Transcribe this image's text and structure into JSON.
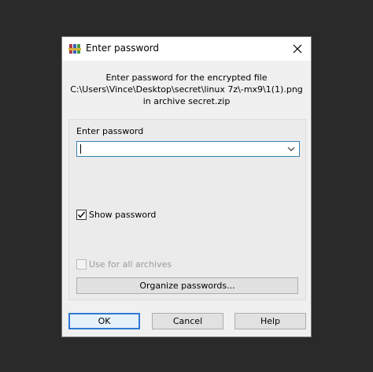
{
  "window": {
    "title": "Enter password",
    "app_icon": "winrar-books-icon",
    "close_icon": "close-icon"
  },
  "info": {
    "line1": "Enter password for the encrypted file",
    "line2": "C:\\Users\\Vince\\Desktop\\secret\\linux 7z\\-mx9\\1(1).png",
    "line3": "in archive secret.zip"
  },
  "password": {
    "label": "Enter password",
    "value": "",
    "dropdown_icon": "chevron-down-icon"
  },
  "options": {
    "show_password": {
      "label": "Show password",
      "checked": true
    },
    "use_for_all": {
      "label": "Use for all archives",
      "checked": false,
      "disabled": true
    }
  },
  "buttons": {
    "organize": "Organize passwords...",
    "ok": "OK",
    "cancel": "Cancel",
    "help": "Help"
  },
  "colors": {
    "accent": "#2f7ad3",
    "background": "#2a2a2a"
  }
}
